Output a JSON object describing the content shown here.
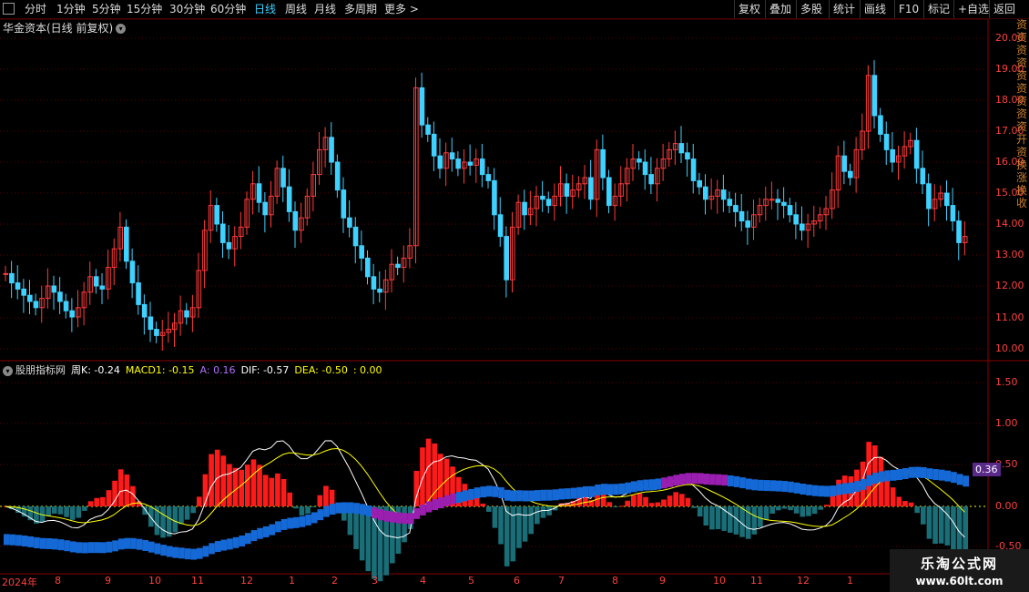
{
  "toolbar": {
    "periods": [
      "分时",
      "1分钟",
      "5分钟",
      "15分钟",
      "30分钟",
      "60分钟",
      "日线",
      "周线",
      "月线",
      "多周期",
      "更多 >"
    ],
    "active_period": "日线",
    "right_buttons": [
      "复权",
      "叠加",
      "多股",
      "统计",
      "画线",
      "F10",
      "标记",
      "+自选",
      "返回"
    ]
  },
  "main": {
    "title": "华金资本(日线 前复权)",
    "y_ticks": [
      "20.00",
      "19.00",
      "18.00",
      "17.00",
      "16.00",
      "15.00",
      "14.00",
      "13.00",
      "12.00",
      "11.00",
      "10.00"
    ]
  },
  "indicator": {
    "name": "股朋指标网",
    "labels": [
      {
        "text": "周K: -0.24",
        "color": "#ffffff"
      },
      {
        "text": "MACD1: -0.15",
        "color": "#ffff00"
      },
      {
        "text": "A: 0.16",
        "color": "#b070ff"
      },
      {
        "text": "DIF: -0.57",
        "color": "#ffffff"
      },
      {
        "text": "DEA: -0.50",
        "color": "#ffff00"
      },
      {
        "text": ": 0.00",
        "color": "#ffff00"
      }
    ],
    "y_ticks": [
      "1.50",
      "1.00",
      "0.50",
      "0.00",
      "-0.50"
    ],
    "badge": "0.36"
  },
  "x_axis": [
    "2024年",
    "8",
    "9",
    "10",
    "11",
    "12",
    "1",
    "2",
    "3",
    "4",
    "5",
    "6",
    "7",
    "8",
    "9",
    "10",
    "11",
    "12",
    "1"
  ],
  "side_strip": "资资资资资资资资资开资换涨换收",
  "watermark": {
    "line1": "乐淘公式网",
    "line2": "www.60lt.com"
  },
  "colors": {
    "up": "#ff3b3b",
    "down": "#3fd1ff",
    "grid": "#5a0000",
    "macd_up": "#ff1a1a",
    "macd_down": "#1a6e78"
  },
  "chart_data": {
    "type": "candlestick",
    "close": [
      12.4,
      12.1,
      11.9,
      11.7,
      11.5,
      11.3,
      11.6,
      12.0,
      11.8,
      11.5,
      11.2,
      11.0,
      11.3,
      11.8,
      12.3,
      12.0,
      11.9,
      12.6,
      13.2,
      13.9,
      12.8,
      12.1,
      11.4,
      11.0,
      10.6,
      10.4,
      10.5,
      10.6,
      10.8,
      11.2,
      11.0,
      11.3,
      12.5,
      13.8,
      14.6,
      14.0,
      13.4,
      13.2,
      13.6,
      13.9,
      14.8,
      15.3,
      14.7,
      14.3,
      14.9,
      15.8,
      15.2,
      14.4,
      13.8,
      14.2,
      14.9,
      15.6,
      16.4,
      16.8,
      16.0,
      15.1,
      14.2,
      13.9,
      13.3,
      12.9,
      12.3,
      11.9,
      11.8,
      12.2,
      12.7,
      12.6,
      12.9,
      13.3,
      18.4,
      17.2,
      16.9,
      16.2,
      15.8,
      16.3,
      16.1,
      15.8,
      16.0,
      15.9,
      16.1,
      15.6,
      15.4,
      14.3,
      13.6,
      12.2,
      13.9,
      14.7,
      14.3,
      14.5,
      14.9,
      14.8,
      14.6,
      14.9,
      15.3,
      14.9,
      15.1,
      15.3,
      15.5,
      14.8,
      16.4,
      15.5,
      14.6,
      14.9,
      15.3,
      15.8,
      16.1,
      16.0,
      15.6,
      15.3,
      15.8,
      16.1,
      16.4,
      16.6,
      16.3,
      16.1,
      15.4,
      15.2,
      14.8,
      14.9,
      15.1,
      14.8,
      14.6,
      14.4,
      14.1,
      13.9,
      14.3,
      14.6,
      14.8,
      14.8,
      14.7,
      14.6,
      14.3,
      14.0,
      13.8,
      14.0,
      14.1,
      14.3,
      14.5,
      15.1,
      16.2,
      15.7,
      15.5,
      16.4,
      17.0,
      18.8,
      17.5,
      16.9,
      16.4,
      16.0,
      16.2,
      16.5,
      16.7,
      15.8,
      15.3,
      14.5,
      14.8,
      15.0,
      14.6,
      14.1,
      13.4,
      13.6
    ]
  }
}
